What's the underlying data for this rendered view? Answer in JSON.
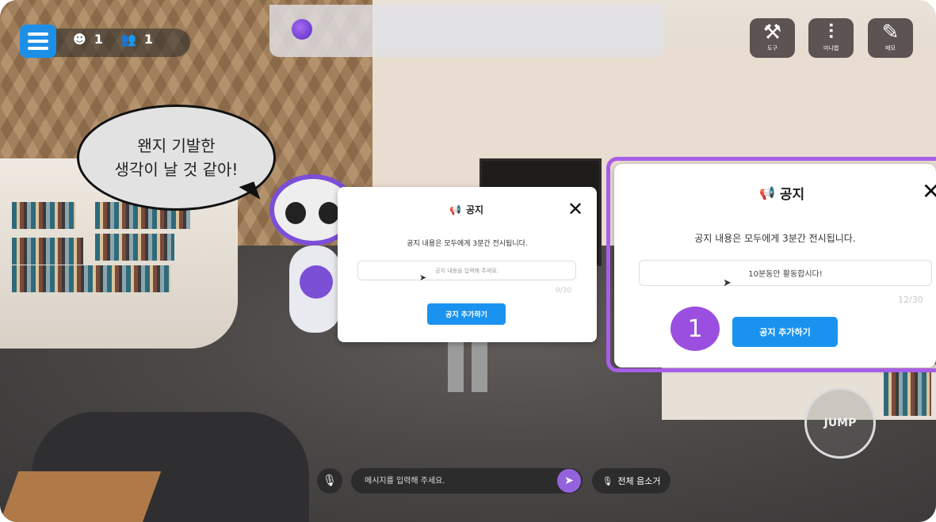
{
  "hud": {
    "avatar_count": "1",
    "users_count": "1"
  },
  "top_right": {
    "tools_label": "도구",
    "minigame_label": "미니맵",
    "memo_label": "메모"
  },
  "speech_bubble": {
    "line1": "왠지 기발한",
    "line2": "생각이 날 것 같아!"
  },
  "notice_small": {
    "title": "공지",
    "description": "공지 내용은 모두에게 3분간 전시됩니다.",
    "input_placeholder": "공지 내용을 입력해 주세요.",
    "char_count": "0/30",
    "add_button": "공지 추가하기"
  },
  "notice_large": {
    "title": "공지",
    "description": "공지 내용은 모두에게 3분간 전시됩니다.",
    "input_value": "10분동안 활동합시다!",
    "char_count": "12/30",
    "add_button": "공지 추가하기"
  },
  "step_badge": "1",
  "jump_label": "JUMP",
  "chat": {
    "placeholder": "메시지를 입력해 주세요.",
    "mute_all_label": "전체 음소거"
  },
  "colors": {
    "accent_blue": "#1a93f0",
    "highlight_purple": "#a85ee8",
    "badge_purple": "#9b4fe0"
  }
}
